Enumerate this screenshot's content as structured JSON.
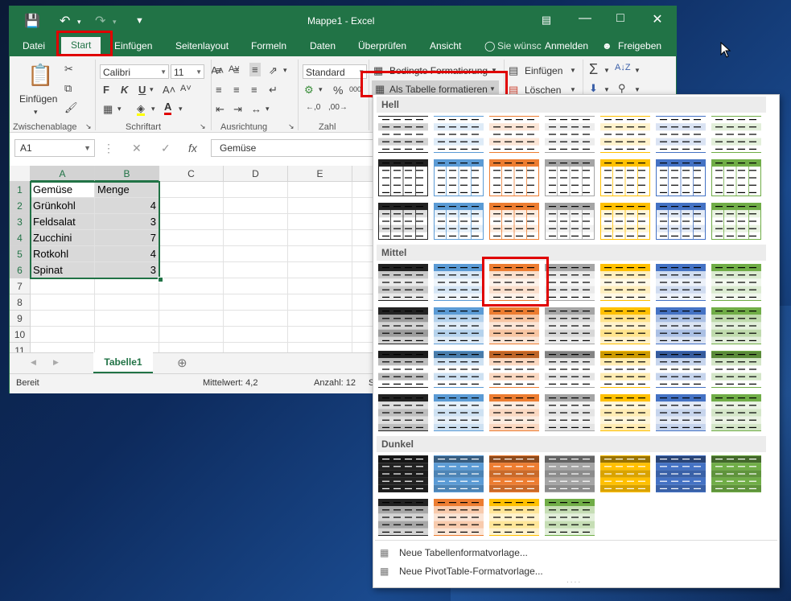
{
  "window": {
    "title": "Mappe1 - Excel",
    "min_icon": "minimize-icon",
    "restore_icon": "restore-icon",
    "close_icon": "close-icon",
    "help_icon": "ribbon-display-icon"
  },
  "qat": {
    "save": "save-icon",
    "undo": "undo-icon",
    "redo": "redo-icon",
    "customize": "customize-qat-icon"
  },
  "tabs": [
    "Datei",
    "Start",
    "Einfügen",
    "Seitenlayout",
    "Formeln",
    "Daten",
    "Überprüfen",
    "Ansicht"
  ],
  "tell_me": "Sie wünsc",
  "signin": "Anmelden",
  "share": "Freigeben",
  "ribbon": {
    "clipboard": {
      "paste": "Einfügen",
      "group": "Zwischenablage"
    },
    "font": {
      "name": "Calibri",
      "size": "11",
      "bold": "F",
      "italic": "K",
      "underline": "U",
      "group": "Schriftart",
      "color_a": "A"
    },
    "alignment": {
      "group": "Ausrichtung"
    },
    "number": {
      "format": "Standard",
      "percent": "%",
      "thousands": "000",
      "group": "Zahl"
    },
    "styles": {
      "conditional": "Bedingte Formatierung",
      "as_table": "Als Tabelle formatieren"
    },
    "cells": {
      "insert": "Einfügen",
      "delete": "Löschen"
    },
    "editing": {
      "sum": "Σ",
      "sort": "A↓Z"
    }
  },
  "formula_bar": {
    "name_box": "A1",
    "fx": "fx",
    "value": "Gemüse"
  },
  "columns": [
    "A",
    "B",
    "C",
    "D",
    "E"
  ],
  "rows": [
    "1",
    "2",
    "3",
    "4",
    "5",
    "6",
    "7",
    "8",
    "9",
    "10",
    "11"
  ],
  "cells": [
    [
      "Gemüse",
      "Menge"
    ],
    [
      "Grünkohl",
      "4"
    ],
    [
      "Feldsalat",
      "3"
    ],
    [
      "Zucchini",
      "7"
    ],
    [
      "Rotkohl",
      "4"
    ],
    [
      "Spinat",
      "3"
    ]
  ],
  "sheet_tab": "Tabelle1",
  "status": {
    "ready": "Bereit",
    "average": "Mittelwert: 4,2",
    "count": "Anzahl: 12",
    "extra": "S"
  },
  "gallery": {
    "sections": [
      "Hell",
      "Mittel",
      "Dunkel"
    ],
    "palette": [
      "#222222",
      "#5b9bd5",
      "#ed7d31",
      "#a5a5a5",
      "#ffc000",
      "#4472c4",
      "#70ad47"
    ],
    "footer": [
      "Neue Tabellenformatvorlage...",
      "Neue PivotTable-Formatvorlage..."
    ],
    "grip": "...."
  }
}
